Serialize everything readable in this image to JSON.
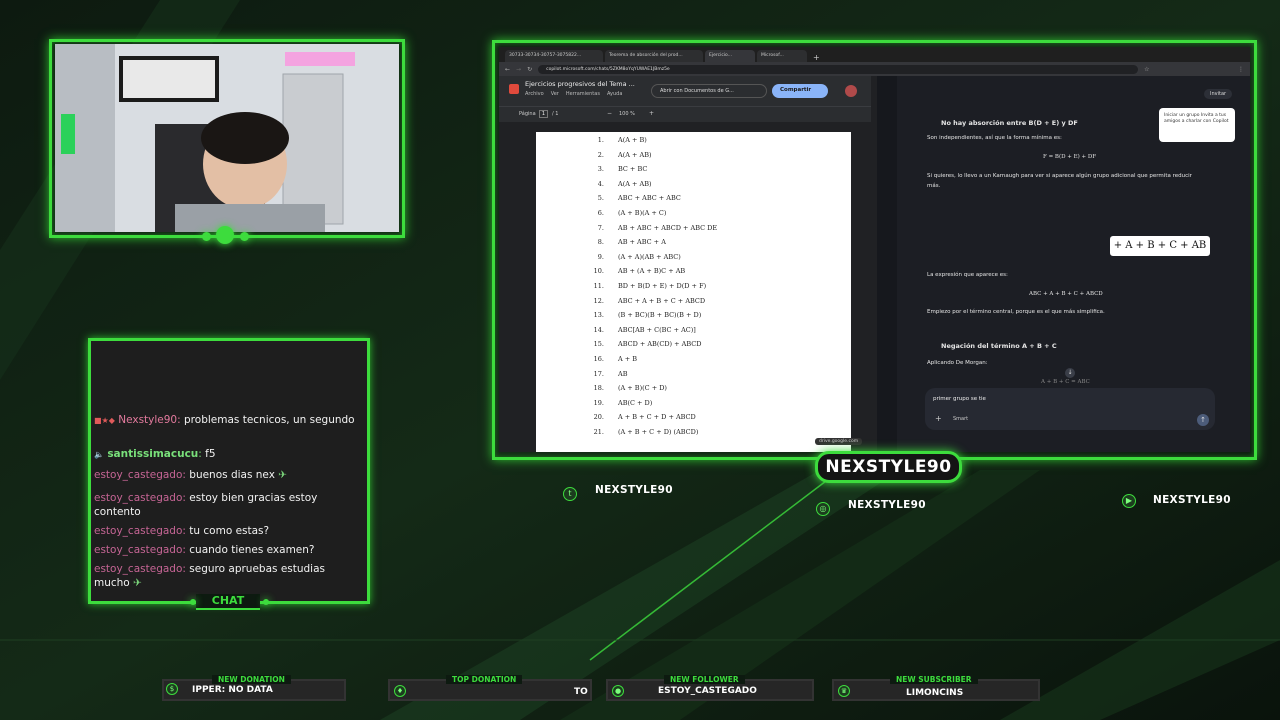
{
  "overlay": {
    "streamer_name": "NEXSTYLE90",
    "chat_label": "CHAT",
    "socials": {
      "twitter": "NEXSTYLE90",
      "instagram": "NEXSTYLE90",
      "youtube": "NEXSTYLE90"
    },
    "bottom_bar": [
      {
        "label": "NEW DONATION",
        "value": "IPPER: NO DATA"
      },
      {
        "label": "TOP DONATION",
        "value": "TO"
      },
      {
        "label": "NEW FOLLOWER",
        "value": "ESTOY_CASTEGADO"
      },
      {
        "label": "NEW SUBSCRIBER",
        "value": "LIMONCINS"
      }
    ],
    "accent": "#3ddc3d"
  },
  "chat": {
    "messages": [
      {
        "user": "Nexstyle90",
        "text": "problemas tecnicos, un segundo"
      },
      {
        "user": "santissimacucu",
        "text": "f5"
      },
      {
        "user": "estoy_castegado",
        "text": "buenos dias nex"
      },
      {
        "user": "estoy_castegado",
        "text": "estoy bien gracias estoy contento"
      },
      {
        "user": "estoy_castegado",
        "text": "tu como estas?"
      },
      {
        "user": "estoy_castegado",
        "text": "cuando tienes examen?"
      },
      {
        "user": "estoy_castegado",
        "text": "seguro apruebas estudias mucho"
      }
    ]
  },
  "browser": {
    "tabs": [
      "30733-30734-30757-3075822...",
      "Teorema de absorción del prod...",
      "Ejercicio...",
      "Microsof..."
    ],
    "url": "copilot.microsoft.com/chats/5ZKM8oYqYUWAE1JBmz5e",
    "pdf": {
      "title": "Ejercicios progresivos del Tema ...",
      "menu": [
        "Archivo",
        "Ver",
        "Herramientas",
        "Ayuda"
      ],
      "open_with": "Abrir con Documentos de G...",
      "share": "Compartir",
      "page_label": "Página",
      "page_current": "1",
      "page_total": "/ 1",
      "zoom": "100 %",
      "equations": [
        "A(A + B)",
        "A(A + AB)",
        "BC + BC",
        "A(A + AB)",
        "ABC + ABC + ABC",
        "(A + B)(A + C)",
        "AB + ABC + ABCD + ABC DE",
        "AB + ABC + A",
        "(A + A)(AB + ABC)",
        "AB + (A + B)C + AB",
        "BD + B(D + E) + D(D + F)",
        "ABC + A + B + C + ABCD",
        "(B + BC)(B + BC)(B + D)",
        "ABC[AB + C(BC + AC)]",
        "ABCD + AB(CD) + ABCD",
        "A + B",
        "AB",
        "(A + B)(C + D)",
        "AB(C + D)",
        "A + B + C + D + ABCD",
        "(A + B + C + D) (ABCD)"
      ],
      "footer_tag": "drive.google.com"
    },
    "copilot": {
      "invite": "Invitar",
      "invite_tip": "Iniciar un grupo Invita a tus amigos a charlar con Copilot",
      "h1": "No hay absorción entre B(D + E) y DF",
      "p1": "Son independientes, así que la forma mínima es:",
      "f1": "F = B(D + E) + DF",
      "p2": "Si quieres, lo llevo a un Karnaugh para ver si aparece algún grupo adicional que permita reducir",
      "p2b": "más.",
      "boxed": "+ A + B + C + AB",
      "p3": "La expresión que aparece es:",
      "f2": "ABC + A + B + C + ABCD",
      "p4": "Empiezo por el término central, porque es el que más simplifica.",
      "h2": "Negación del término A + B + C",
      "p5": "Aplicando De Morgan:",
      "f3": "A + B + C = ABC",
      "input": "primer grupo se tie",
      "mode": "Smart"
    }
  }
}
